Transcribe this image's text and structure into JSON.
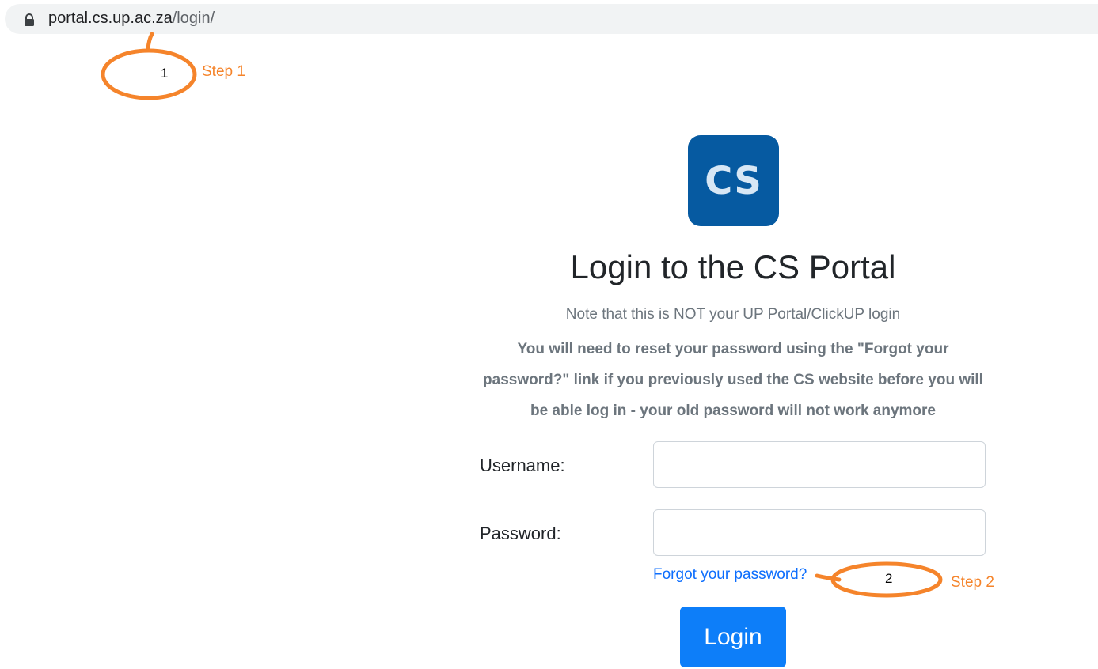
{
  "browser": {
    "url_domain": "portal.cs.up.ac.za",
    "url_path": "/login/",
    "lock_icon": "lock-icon"
  },
  "annotations": {
    "color": "#f5842b",
    "step1_number": "1",
    "step1_label": "Step 1",
    "step2_number": "2",
    "step2_label": "Step 2"
  },
  "logo": {
    "text": "CS",
    "background": "#065aa1"
  },
  "login": {
    "title": "Login to the CS Portal",
    "note": "Note that this is NOT your UP Portal/ClickUP login",
    "warning": "You will need to reset your password using the \"Forgot your password?\" link if you previously used the CS website before you will be able log in - your old password will not work anymore",
    "username_label": "Username:",
    "username_value": "",
    "password_label": "Password:",
    "password_value": "",
    "forgot_link": "Forgot your password?",
    "login_button": "Login",
    "button_color": "#0d7ef9",
    "link_color": "#0d6efd"
  }
}
